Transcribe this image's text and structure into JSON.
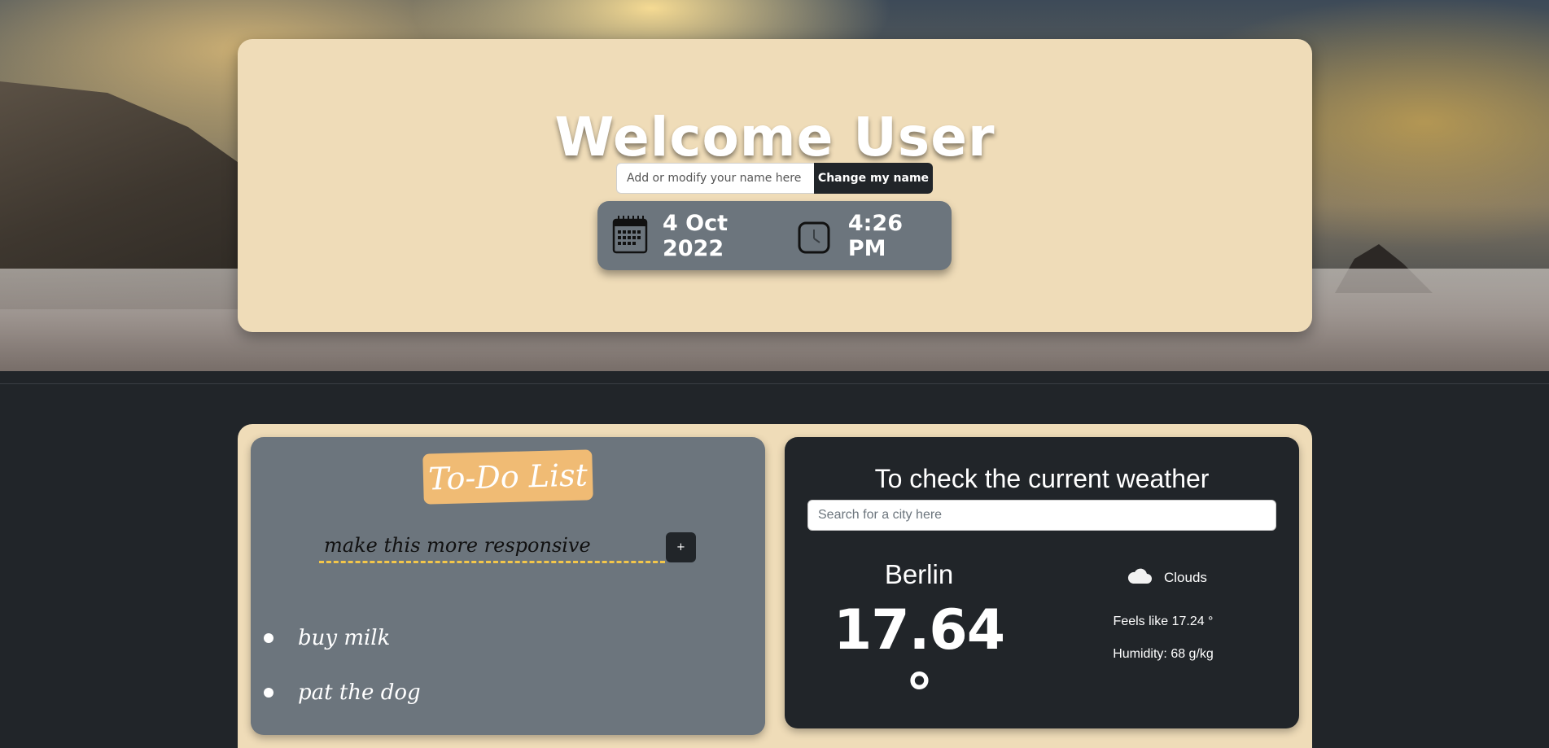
{
  "header": {
    "welcome_title": "Welcome User",
    "name_placeholder": "Add or modify your name here",
    "name_button_label": "Change my name",
    "date": "4 Oct 2022",
    "time": "4:26 PM",
    "date_icon": "calendar-icon",
    "time_icon": "clock-icon"
  },
  "todo": {
    "title": "To-Do List",
    "input_value": "make this more responsive",
    "add_button_label": "+",
    "items": [
      {
        "label": "buy milk"
      },
      {
        "label": "pat the dog"
      }
    ]
  },
  "weather": {
    "title": "To check the current weather",
    "search_placeholder": "Search for a city here",
    "city": "Berlin",
    "temperature": "17.64 °",
    "condition": "Clouds",
    "condition_icon": "cloud-icon",
    "feels_like": "Feels like 17.24 °",
    "humidity": "Humidity: 68 g/kg"
  },
  "colors": {
    "card_bg": "#efdcb8",
    "dark": "#212529",
    "gray_panel": "#6c757d",
    "todo_title_bg": "#f0bb74",
    "dashed_underline": "#f3c64a"
  }
}
